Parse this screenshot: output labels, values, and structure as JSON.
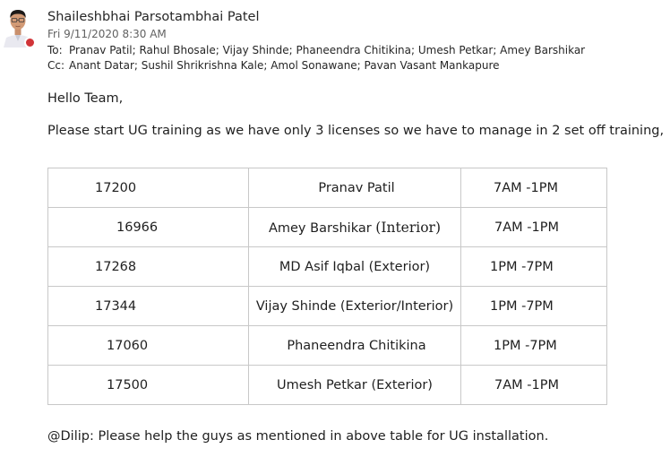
{
  "message": {
    "sender_name": "Shaileshbhai Parsotambhai Patel",
    "sent_date": "Fri 9/11/2020 8:30 AM",
    "to_label": "To:",
    "to_recipients": "Pranav Patil; Rahul Bhosale; Vijay Shinde; Phaneendra Chitikina; Umesh Petkar; Amey Barshikar",
    "cc_label": "Cc:",
    "cc_recipients": "Anant Datar; Sushil Shrikrishna Kale; Amol Sonawane; Pavan Vasant Mankapure",
    "presence_status_color": "#d13438"
  },
  "body": {
    "greeting": "Hello Team,",
    "intro": "Please start UG training as we have only 3 licenses so we have to manage in 2 set off training,",
    "table_rows": [
      {
        "id": "17200",
        "name": "Pranav Patil",
        "name_suffix": "",
        "time": "7AM -1PM"
      },
      {
        "id": "16966",
        "name": "Amey Barshikar ",
        "name_suffix": "(Interior)",
        "time": "7AM -1PM"
      },
      {
        "id": "17268",
        "name": "MD Asif Iqbal (Exterior)",
        "name_suffix": "",
        "time": "1PM -7PM"
      },
      {
        "id": "17344",
        "name": "Vijay Shinde (Exterior/Interior)",
        "name_suffix": "",
        "time": "1PM -7PM"
      },
      {
        "id": "17060",
        "name": "Phaneendra Chitikina",
        "name_suffix": "",
        "time": "1PM -7PM"
      },
      {
        "id": "17500",
        "name": "Umesh Petkar (Exterior)",
        "name_suffix": "",
        "time": "7AM -1PM"
      }
    ],
    "closing": "@Dilip: Please help the guys as mentioned in above table for UG installation."
  }
}
